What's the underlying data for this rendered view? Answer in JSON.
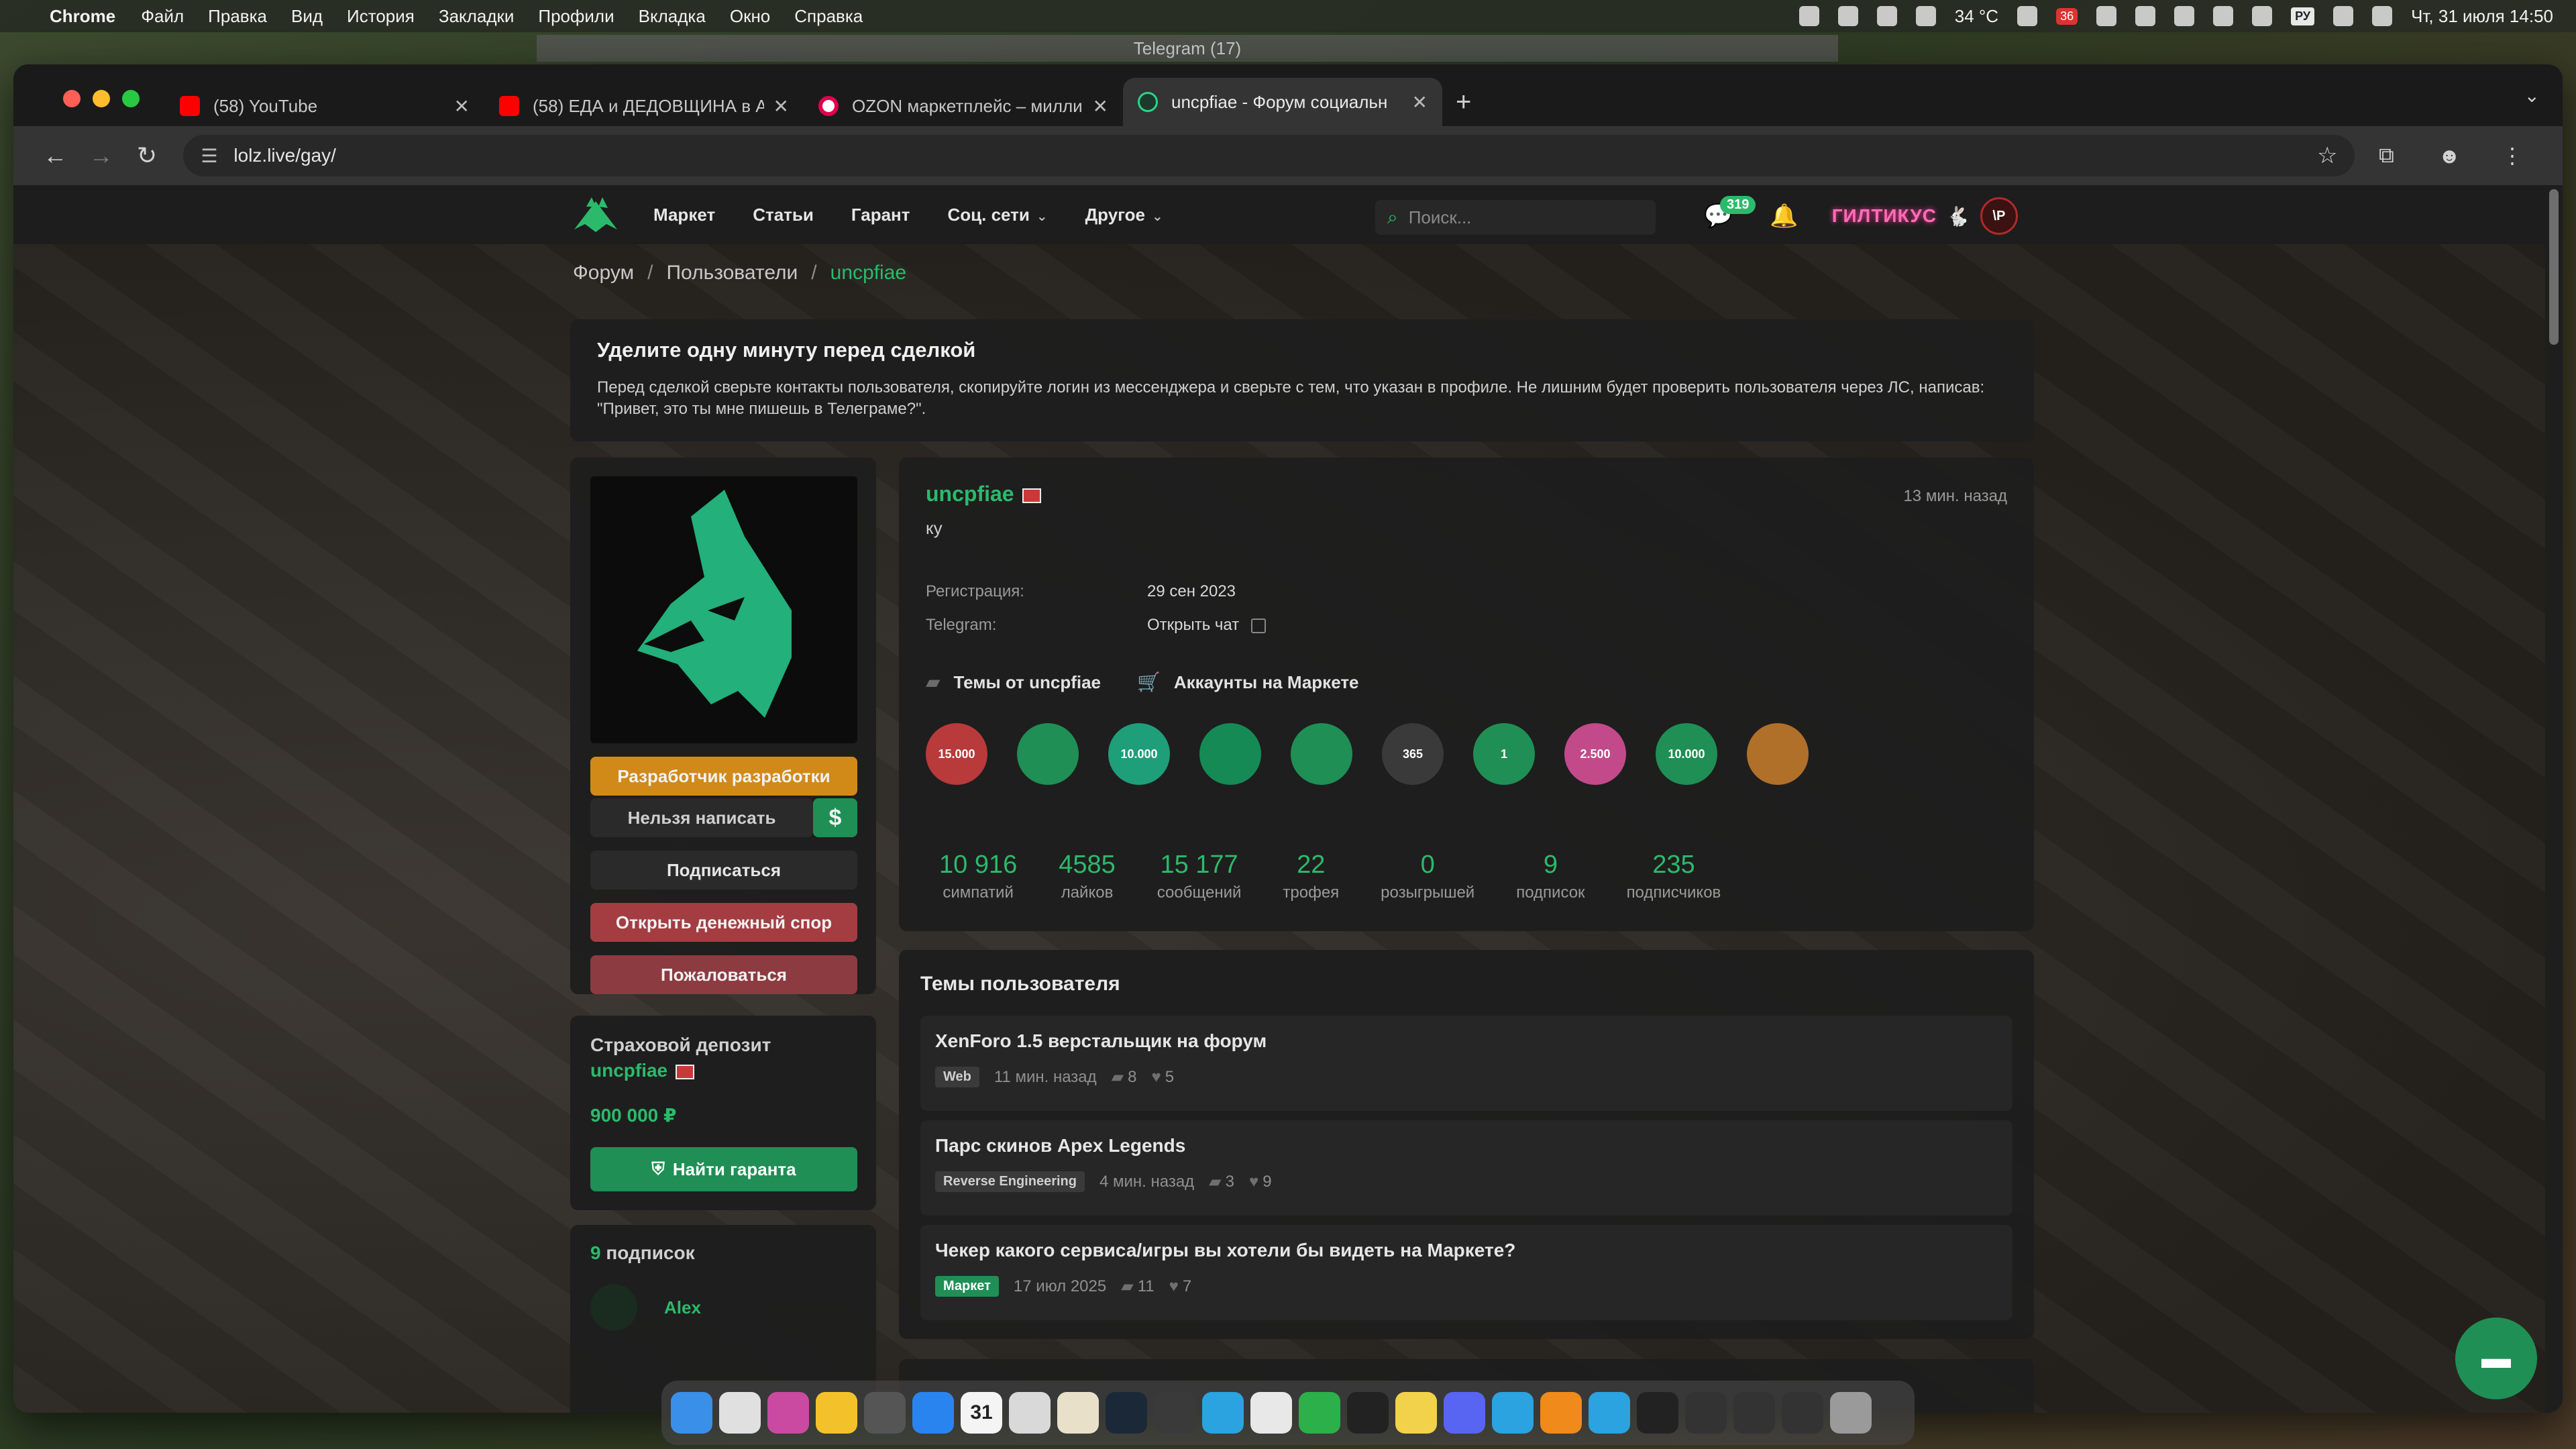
{
  "menubar": {
    "app_name": "Chrome",
    "menus": [
      "Файл",
      "Правка",
      "Вид",
      "История",
      "Закладки",
      "Профили",
      "Вкладка",
      "Окно",
      "Справка"
    ],
    "weather": "34 °C",
    "battery_badge": "36",
    "keyboard_lang": "РУ",
    "datetime": "Чт, 31 июля  14:50"
  },
  "telegram_window_title": "Telegram (17)",
  "browser": {
    "tabs": [
      {
        "title": "(58) YouTube",
        "favicon": "youtube-icon",
        "active": false
      },
      {
        "title": "(58) ЕДА и ДЕДОВЩИНА в А",
        "favicon": "youtube-icon",
        "active": false
      },
      {
        "title": "OZON маркетплейс – милли",
        "favicon": "ozon-icon",
        "active": false
      },
      {
        "title": "uncpfiae - Форум социальн",
        "favicon": "lolz-icon",
        "active": true
      }
    ],
    "url": "lolz.live/gay/"
  },
  "site": {
    "nav": [
      "Маркет",
      "Статьи",
      "Гарант",
      "Соц. сети",
      "Другое"
    ],
    "search_placeholder": "Поиск...",
    "chat_badge": "319",
    "user_nick": "ГИЛТИКУС",
    "user_avatar_text": "\\P",
    "accent_color": "#2bba6b"
  },
  "breadcrumbs": [
    "Форум",
    "Пользователи",
    "uncpfiae"
  ],
  "notice": {
    "title": "Уделите одну минуту перед сделкой",
    "text": "Перед сделкой сверьте контакты пользователя, скопируйте логин из мессенджера и сверьте с тем, что указан в профиле. Не лишним будет проверить пользователя через ЛС, написав: \"Привет, это ты мне пишешь в Телеграме?\"."
  },
  "profile": {
    "username": "uncpfiae",
    "status": "ку",
    "last_seen": "13 мин. назад",
    "registration_label": "Регистрация:",
    "registration_value": "29 сен 2023",
    "telegram_label": "Telegram:",
    "telegram_value": "Открыть чат",
    "threads_link": "Темы от uncpfiae",
    "market_link": "Аккаунты на Маркете",
    "buttons": {
      "developer": "Разработчик разработки",
      "cannot_write": "Нельзя написать",
      "dollar": "$",
      "subscribe": "Подписаться",
      "dispute": "Открыть денежный спор",
      "report": "Пожаловаться"
    },
    "trophies": [
      {
        "label": "15.000",
        "color": "#b83a3a"
      },
      {
        "label": "",
        "color": "#1f8f55"
      },
      {
        "label": "10.000",
        "color": "#1f9e7a"
      },
      {
        "label": "",
        "color": "#158a55"
      },
      {
        "label": "",
        "color": "#1f8f55"
      },
      {
        "label": "365",
        "color": "#3a3a3a"
      },
      {
        "label": "1",
        "color": "#1f8f55"
      },
      {
        "label": "2.500",
        "color": "#c24a8a"
      },
      {
        "label": "10.000",
        "color": "#1f8f55"
      },
      {
        "label": "",
        "color": "#b0702a"
      }
    ],
    "stats": [
      {
        "value": "10 916",
        "label": "симпатий"
      },
      {
        "value": "4585",
        "label": "лайков"
      },
      {
        "value": "15 177",
        "label": "сообщений"
      },
      {
        "value": "22",
        "label": "трофея"
      },
      {
        "value": "0",
        "label": "розыгрышей"
      },
      {
        "value": "9",
        "label": "подписок"
      },
      {
        "value": "235",
        "label": "подписчиков"
      }
    ]
  },
  "deposit": {
    "title": "Страховой депозит",
    "user": "uncpfiae",
    "amount": "900 000 ₽",
    "button": "Найти гаранта"
  },
  "subscriptions": {
    "count": "9",
    "title_suffix": "подписок",
    "first_name": "Alex"
  },
  "threads": {
    "title": "Темы пользователя",
    "items": [
      {
        "title": "XenForo 1.5 верстальщик на форум",
        "tag": "Web",
        "tag_green": false,
        "time": "11 мин. назад",
        "replies": "8",
        "likes": "5"
      },
      {
        "title": "Парс скинов Apex Legends",
        "tag": "Reverse Engineering",
        "tag_green": false,
        "time": "4 мин. назад",
        "replies": "3",
        "likes": "9"
      },
      {
        "title": "Чекер какого сервиса/игры вы хотели бы видеть на Маркете?",
        "tag": "Маркет",
        "tag_green": true,
        "time": "17 июл 2025",
        "replies": "11",
        "likes": "7"
      }
    ]
  },
  "dock_icons": [
    "finder-icon",
    "chrome-icon",
    "arc-icon",
    "spark-icon",
    "settings-icon",
    "appstore-icon",
    "calendar-icon",
    "notes-icon",
    "launchpad-icon",
    "steam-icon",
    "rocket-icon",
    "telegram-icon",
    "chatgpt-icon",
    "utorrent-icon",
    "terminal-icon",
    "notes-yellow-icon",
    "discord-icon",
    "telegram-icon-2",
    "sublime-icon",
    "telegram-icon-3",
    "activity-icon",
    "window-1",
    "window-2",
    "window-3",
    "trash-icon"
  ],
  "dock_calendar_day": "31"
}
